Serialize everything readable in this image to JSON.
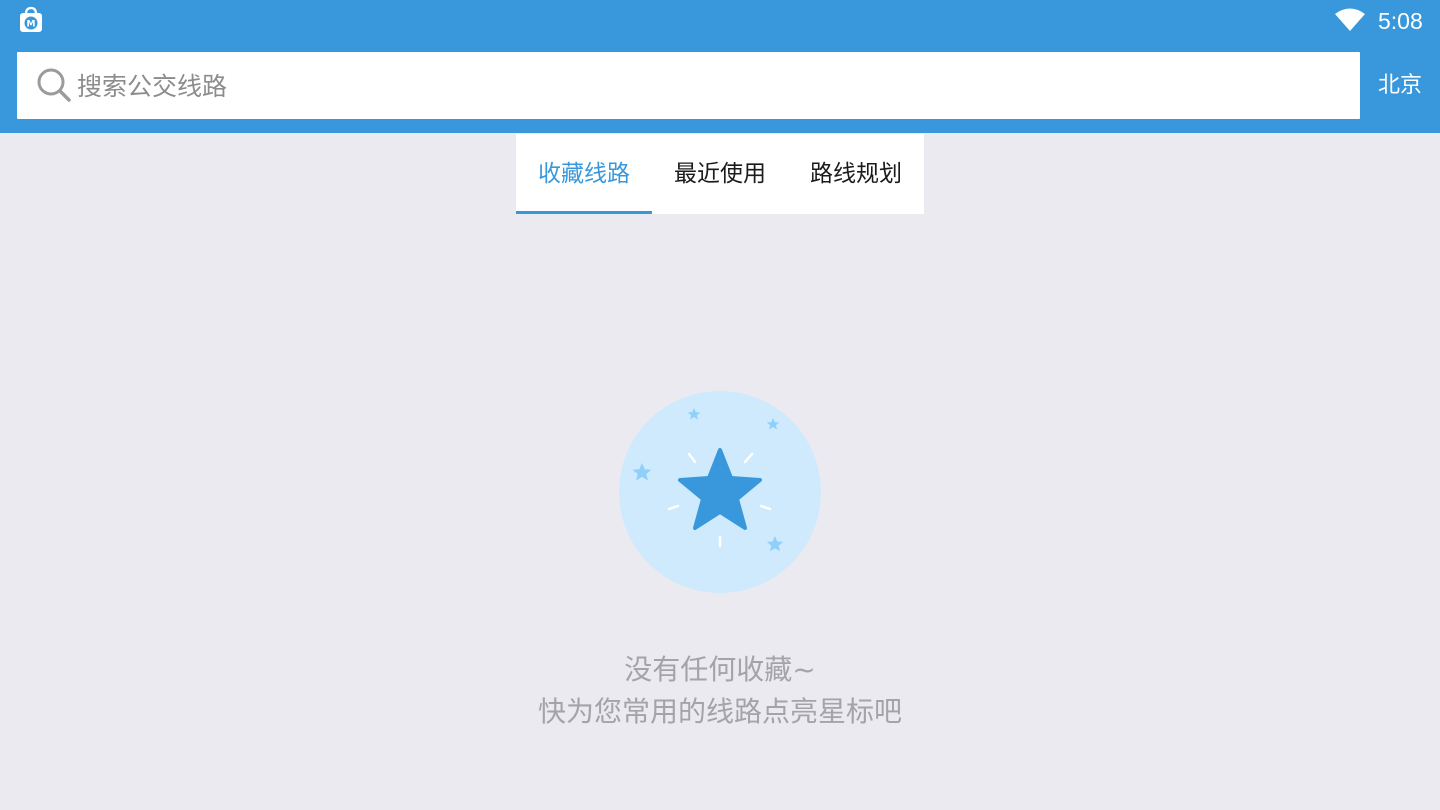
{
  "status_bar": {
    "app_icon": "shopping-bag-icon",
    "wifi_icon": "wifi-icon",
    "time": "5:08"
  },
  "search": {
    "icon": "search-icon",
    "placeholder": "搜索公交线路",
    "value": ""
  },
  "city": {
    "label": "北京"
  },
  "tabs": [
    {
      "label": "收藏线路",
      "active": true
    },
    {
      "label": "最近使用",
      "active": false
    },
    {
      "label": "路线规划",
      "active": false
    }
  ],
  "empty_state": {
    "icon": "favorite-star-icon",
    "title": "没有任何收藏~",
    "hint": "快为您常用的线路点亮星标吧"
  },
  "colors": {
    "accent": "#3898db",
    "background": "#ebeaf0",
    "illustration_circle": "#cfeafd",
    "muted_text": "#a3a3a8"
  }
}
